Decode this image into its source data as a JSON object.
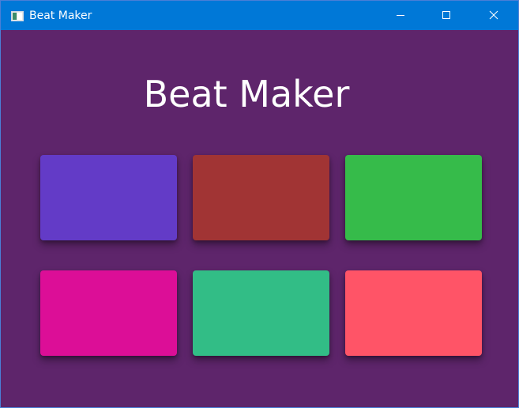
{
  "window": {
    "title": "Beat Maker",
    "titlebar_color": "#0078d7",
    "background_color": "#5e256b",
    "controls": {
      "minimize_icon": "minimize-icon",
      "maximize_icon": "maximize-icon",
      "close_icon": "close-icon"
    }
  },
  "main": {
    "heading": "Beat Maker",
    "pads": [
      {
        "color": "#633bc7"
      },
      {
        "color": "#a13434"
      },
      {
        "color": "#36bb4a"
      },
      {
        "color": "#dc0e97"
      },
      {
        "color": "#32bd86"
      },
      {
        "color": "#ff5467"
      }
    ]
  }
}
